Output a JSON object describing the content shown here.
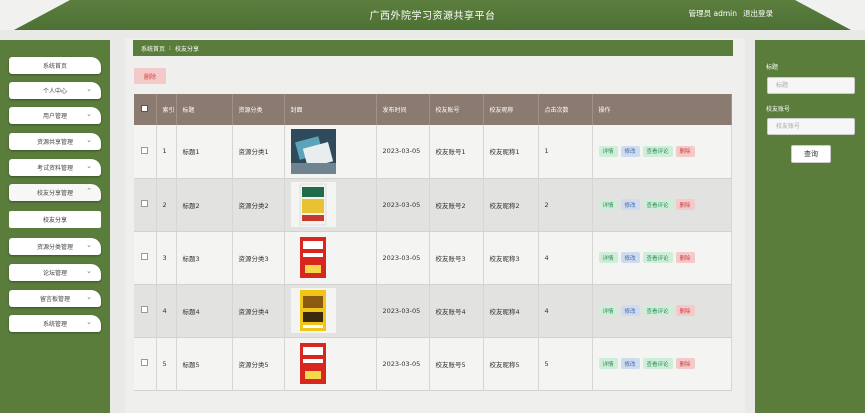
{
  "header": {
    "title": "广西外院学习资源共享平台",
    "user_label": "管理员 admin",
    "logout_label": "退出登录"
  },
  "sidebar": {
    "items": [
      {
        "label": "系统首页",
        "chevron": ""
      },
      {
        "label": "个人中心",
        "chevron": "⌄"
      },
      {
        "label": "用户管理",
        "chevron": "⌄"
      },
      {
        "label": "资源共享管理",
        "chevron": "⌄"
      },
      {
        "label": "考试资料管理",
        "chevron": "⌄"
      },
      {
        "label": "校友分享管理",
        "chevron": "⌃"
      },
      {
        "label": "资源分类管理",
        "chevron": "⌄"
      },
      {
        "label": "论坛管理",
        "chevron": "⌄"
      },
      {
        "label": "留言板管理",
        "chevron": "⌄"
      },
      {
        "label": "系统管理",
        "chevron": "⌄"
      }
    ],
    "submenu": {
      "label": "校友分享"
    }
  },
  "breadcrumb": {
    "home": "系统首页",
    "separator": "⁝",
    "current": "校友分享"
  },
  "toolbar": {
    "delete_label": "删除"
  },
  "table": {
    "headers": [
      "索引",
      "标题",
      "资源分类",
      "封面",
      "发布时间",
      "校友账号",
      "校友昵称",
      "点击次数",
      "操作"
    ],
    "ops": {
      "detail": "详情",
      "edit": "修改",
      "comments": "查看评论",
      "delete": "删除"
    },
    "rows": [
      {
        "index": "1",
        "title": "标题1",
        "category": "资源分类1",
        "date": "2023-03-05",
        "account": "校友账号1",
        "nickname": "校友昵称1",
        "clicks": "1"
      },
      {
        "index": "2",
        "title": "标题2",
        "category": "资源分类2",
        "date": "2023-03-05",
        "account": "校友账号2",
        "nickname": "校友昵称2",
        "clicks": "2"
      },
      {
        "index": "3",
        "title": "标题3",
        "category": "资源分类3",
        "date": "2023-03-05",
        "account": "校友账号3",
        "nickname": "校友昵称3",
        "clicks": "4"
      },
      {
        "index": "4",
        "title": "标题4",
        "category": "资源分类4",
        "date": "2023-03-05",
        "account": "校友账号4",
        "nickname": "校友昵称4",
        "clicks": "4"
      },
      {
        "index": "5",
        "title": "标题5",
        "category": "资源分类5",
        "date": "2023-03-05",
        "account": "校友账号5",
        "nickname": "校友昵称5",
        "clicks": "5"
      }
    ]
  },
  "search": {
    "title_label": "标题",
    "title_placeholder": "标题",
    "account_label": "校友账号",
    "account_placeholder": "校友账号",
    "button_label": "查询"
  },
  "colors": {
    "header_green": "#4d7034",
    "sidebar_green": "#5a7d3c",
    "table_header": "#8b7a70"
  }
}
